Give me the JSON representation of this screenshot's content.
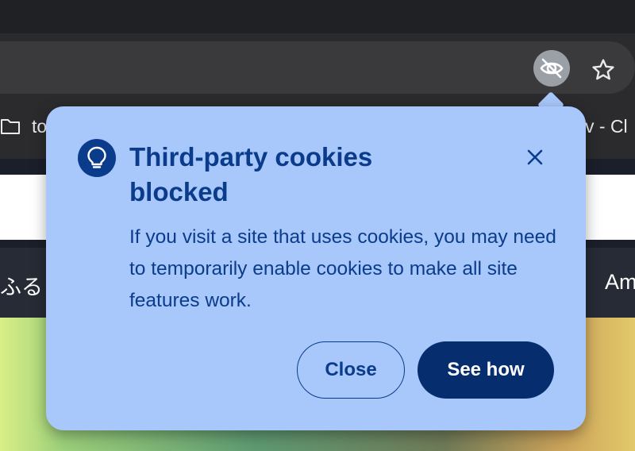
{
  "browser": {
    "toolbar": {
      "cookie_icon": "eye-slash-icon",
      "bookmark_star_icon": "star-icon"
    },
    "bookmarks_bar": {
      "folder_icon": "folder-icon",
      "left_item_text": "to",
      "right_item_text": "v - Cl"
    }
  },
  "page": {
    "nav_left_text": "ふるさ",
    "nav_right_text": "Am"
  },
  "popup": {
    "icon": "lightbulb-icon",
    "title": "Third-party cookies blocked",
    "body": "If you visit a site that uses cookies, you may need to temporarily enable cookies to make all site features work.",
    "close_icon": "close-icon",
    "close_label": "Close",
    "see_how_label": "See how"
  },
  "colors": {
    "popup_background": "#a8c7fa",
    "accent": "#0b3c8c",
    "primary_button": "#062e6f"
  }
}
